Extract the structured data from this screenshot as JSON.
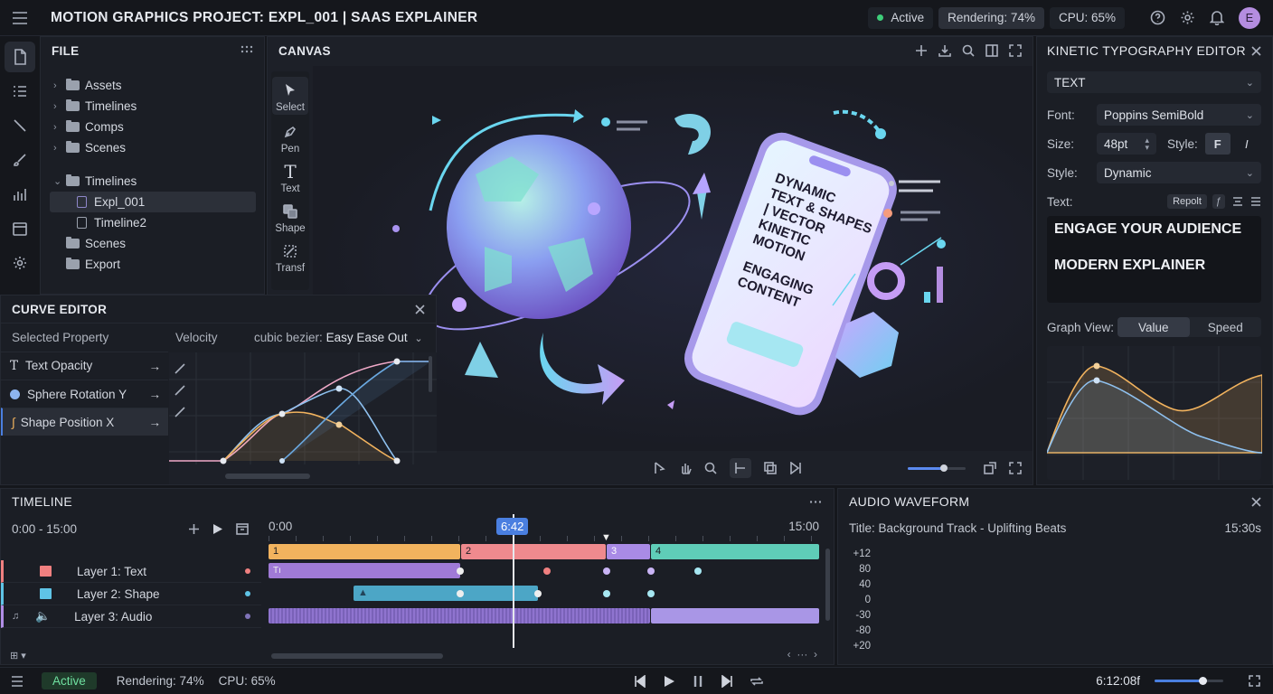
{
  "app": {
    "title": "MOTION GRAPHICS PROJECT: EXPL_001 | SAAS EXPLAINER",
    "status_active": "Active",
    "status_rendering": "Rendering: 74%",
    "status_cpu": "CPU: 65%",
    "avatar_initial": "E"
  },
  "file_panel": {
    "title": "FILE",
    "items": [
      {
        "label": "Assets"
      },
      {
        "label": "Timelines"
      },
      {
        "label": "Comps"
      },
      {
        "label": "Scenes"
      },
      {
        "label": "Timelines"
      },
      {
        "label": "Expl_001"
      },
      {
        "label": "Timeline2"
      },
      {
        "label": "Scenes"
      },
      {
        "label": "Export"
      }
    ]
  },
  "canvas": {
    "title": "CANVAS",
    "tools": [
      {
        "label": "Select"
      },
      {
        "label": "Pen"
      },
      {
        "label": "Text"
      },
      {
        "label": "Shape"
      },
      {
        "label": "Transf"
      }
    ],
    "phone_text_1": "DYNAMIC",
    "phone_text_2": "TEXT & SHAPES",
    "phone_text_3": "| VECTOR",
    "phone_text_4": "KINETIC",
    "phone_text_5": "MOTION",
    "phone_text_6": "ENGAGING",
    "phone_text_7": "CONTENT",
    "zoom_level": 0.62
  },
  "curve_editor": {
    "title": "CURVE EDITOR",
    "selected_property_label": "Selected Property",
    "velocity_label": "Velocity",
    "easing_prefix": "cubic bezier:",
    "easing_value": "Easy Ease Out",
    "properties": [
      {
        "label": "Text Opacity"
      },
      {
        "label": "Sphere Rotation Y"
      },
      {
        "label": "Shape Position X"
      }
    ]
  },
  "typography": {
    "title": "KINETIC TYPOGRAPHY EDITOR",
    "section": "TEXT",
    "font_label": "Font:",
    "font_value": "Poppins SemiBold",
    "size_label": "Size:",
    "size_value": "48pt",
    "style_label_1": "Style:",
    "style_label_2": "Style:",
    "style_value": "Dynamic",
    "text_label": "Text:",
    "repolt_label": "Repolt",
    "text_line_1": "ENGAGE YOUR AUDIENCE",
    "text_line_2": "MODERN EXPLAINER",
    "graph_view_label": "Graph View:",
    "graph_value": "Value",
    "graph_speed": "Speed"
  },
  "timeline": {
    "title": "TIMELINE",
    "range": "0:00 - 15:00",
    "start": "0:00",
    "end": "15:00",
    "playhead": "6:42",
    "layers": [
      {
        "label": "Layer 1: Text",
        "color": "#f08080"
      },
      {
        "label": "Layer 2: Shape",
        "color": "#5fc4e6"
      },
      {
        "label": "Layer 3: Audio",
        "color": "#b18ee6"
      }
    ],
    "segments": [
      {
        "label": "1",
        "color": "#f2b35e"
      },
      {
        "label": "2",
        "color": "#ef8a8e"
      },
      {
        "label": "3",
        "color": "#a98be6"
      },
      {
        "label": "4",
        "color": "#5fcdb8"
      }
    ]
  },
  "audio": {
    "title": "AUDIO WAVEFORM",
    "track": "Title: Background Track - Uplifting Beats",
    "duration": "15:30s",
    "db_labels": [
      "+12",
      "80",
      "40",
      "0",
      "-30",
      "-80",
      "+20"
    ]
  },
  "statusbar": {
    "active": "Active",
    "rendering": "Rendering: 74%",
    "cpu": "CPU: 65%",
    "timecode": "6:12:08f",
    "volume": 0.7
  },
  "colors": {
    "accent_blue": "#4a7fe0",
    "active_green": "#3ecf7a"
  }
}
